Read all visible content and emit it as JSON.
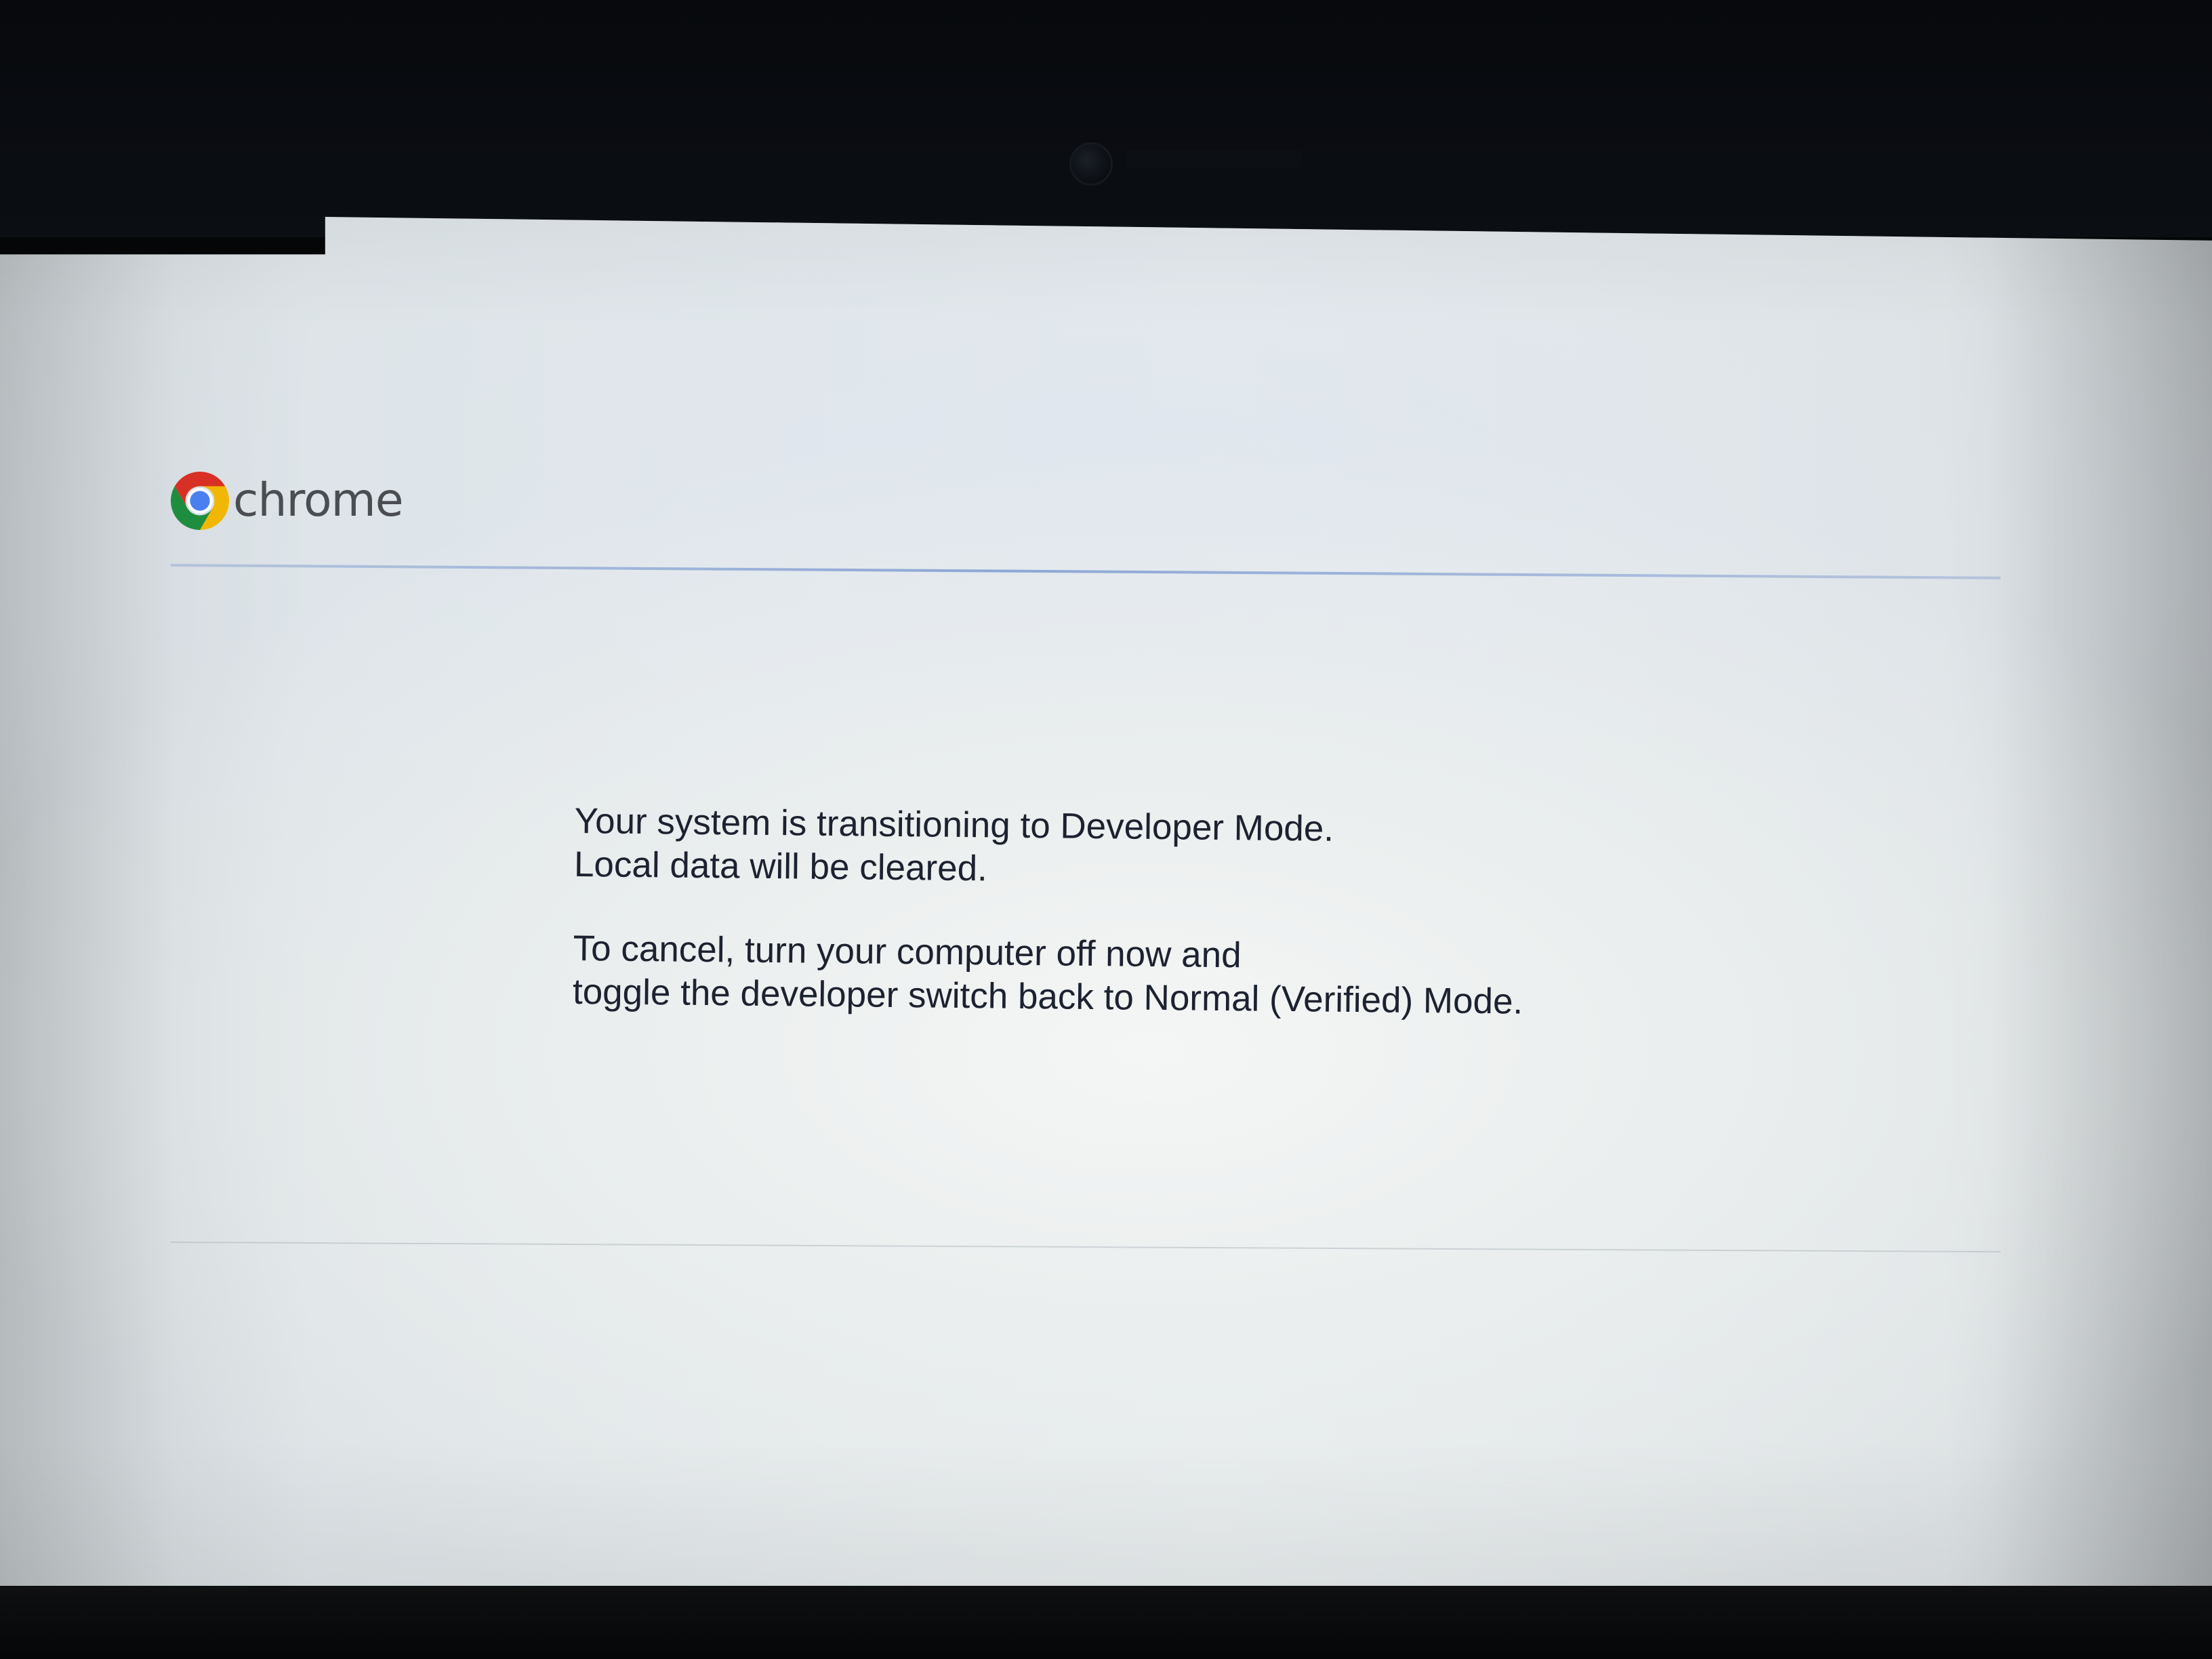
{
  "header": {
    "brand_name": "chrome",
    "logo_icon": "chrome-logo-icon",
    "logo_colors": {
      "red": "#d93025",
      "yellow": "#f2b705",
      "green": "#1e8e3e",
      "blue": "#4a7ff0"
    }
  },
  "message": {
    "line_1": "Your system is transitioning to Developer Mode.",
    "line_2": "Local data will be cleared.",
    "line_3": "To cancel, turn your computer off now and",
    "line_4": "toggle the developer switch back to Normal (Verified) Mode."
  },
  "colors": {
    "screen_background": "#e6ebed",
    "text": "#1d2230",
    "divider": "#8ea8d6",
    "bezel": "#050608"
  }
}
